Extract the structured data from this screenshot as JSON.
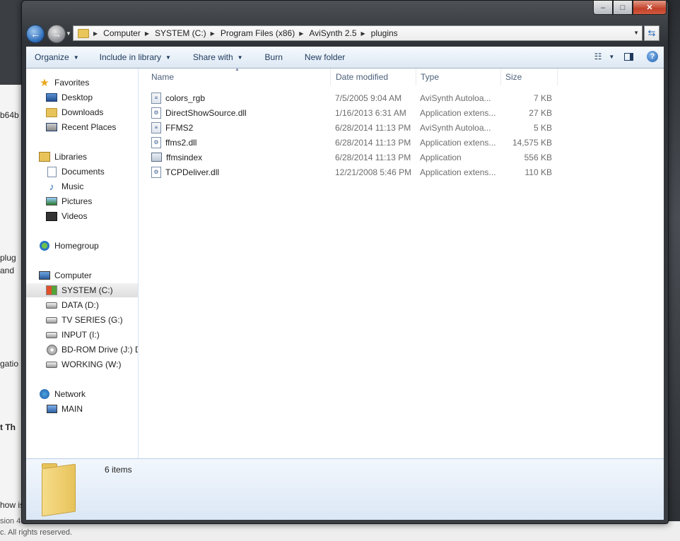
{
  "window": {
    "caption": {
      "min": "–",
      "max": "□",
      "close": "✕"
    }
  },
  "background": {
    "left_fragments": [
      "b64b",
      "plug",
      "and",
      "gatio",
      "t Th",
      "how is",
      "sion 4.",
      "c. All rights reserved."
    ]
  },
  "address_bar": {
    "crumbs": [
      "Computer",
      "SYSTEM (C:)",
      "Program Files (x86)",
      "AviSynth 2.5",
      "plugins"
    ]
  },
  "toolbar": {
    "organize": "Organize",
    "include_in_library": "Include in library",
    "share_with": "Share with",
    "burn": "Burn",
    "new_folder": "New folder",
    "help": "?"
  },
  "nav": {
    "favorites": "Favorites",
    "desktop": "Desktop",
    "downloads": "Downloads",
    "recent_places": "Recent Places",
    "libraries": "Libraries",
    "documents": "Documents",
    "music": "Music",
    "pictures": "Pictures",
    "videos": "Videos",
    "homegroup": "Homegroup",
    "computer": "Computer",
    "drives": [
      "SYSTEM (C:)",
      "DATA (D:)",
      "TV SERIES (G:)",
      "INPUT (I:)",
      "BD-ROM Drive (J:) D",
      "WORKING (W:)"
    ],
    "network": "Network",
    "main": "MAIN"
  },
  "columns": {
    "name": "Name",
    "date_modified": "Date modified",
    "type": "Type",
    "size": "Size"
  },
  "files": [
    {
      "name": "colors_rgb",
      "date": "7/5/2005 9:04 AM",
      "type": "AviSynth Autoloa...",
      "size": "7 KB",
      "icon": "script-icon"
    },
    {
      "name": "DirectShowSource.dll",
      "date": "1/16/2013 6:31 AM",
      "type": "Application extens...",
      "size": "27 KB",
      "icon": "dll-icon"
    },
    {
      "name": "FFMS2",
      "date": "6/28/2014 11:13 PM",
      "type": "AviSynth Autoloa...",
      "size": "5 KB",
      "icon": "script-icon"
    },
    {
      "name": "ffms2.dll",
      "date": "6/28/2014 11:13 PM",
      "type": "Application extens...",
      "size": "14,575 KB",
      "icon": "dll-icon"
    },
    {
      "name": "ffmsindex",
      "date": "6/28/2014 11:13 PM",
      "type": "Application",
      "size": "556 KB",
      "icon": "app-icon"
    },
    {
      "name": "TCPDeliver.dll",
      "date": "12/21/2008 5:46 PM",
      "type": "Application extens...",
      "size": "110 KB",
      "icon": "dll-icon"
    }
  ],
  "details": {
    "item_count": "6 items"
  }
}
